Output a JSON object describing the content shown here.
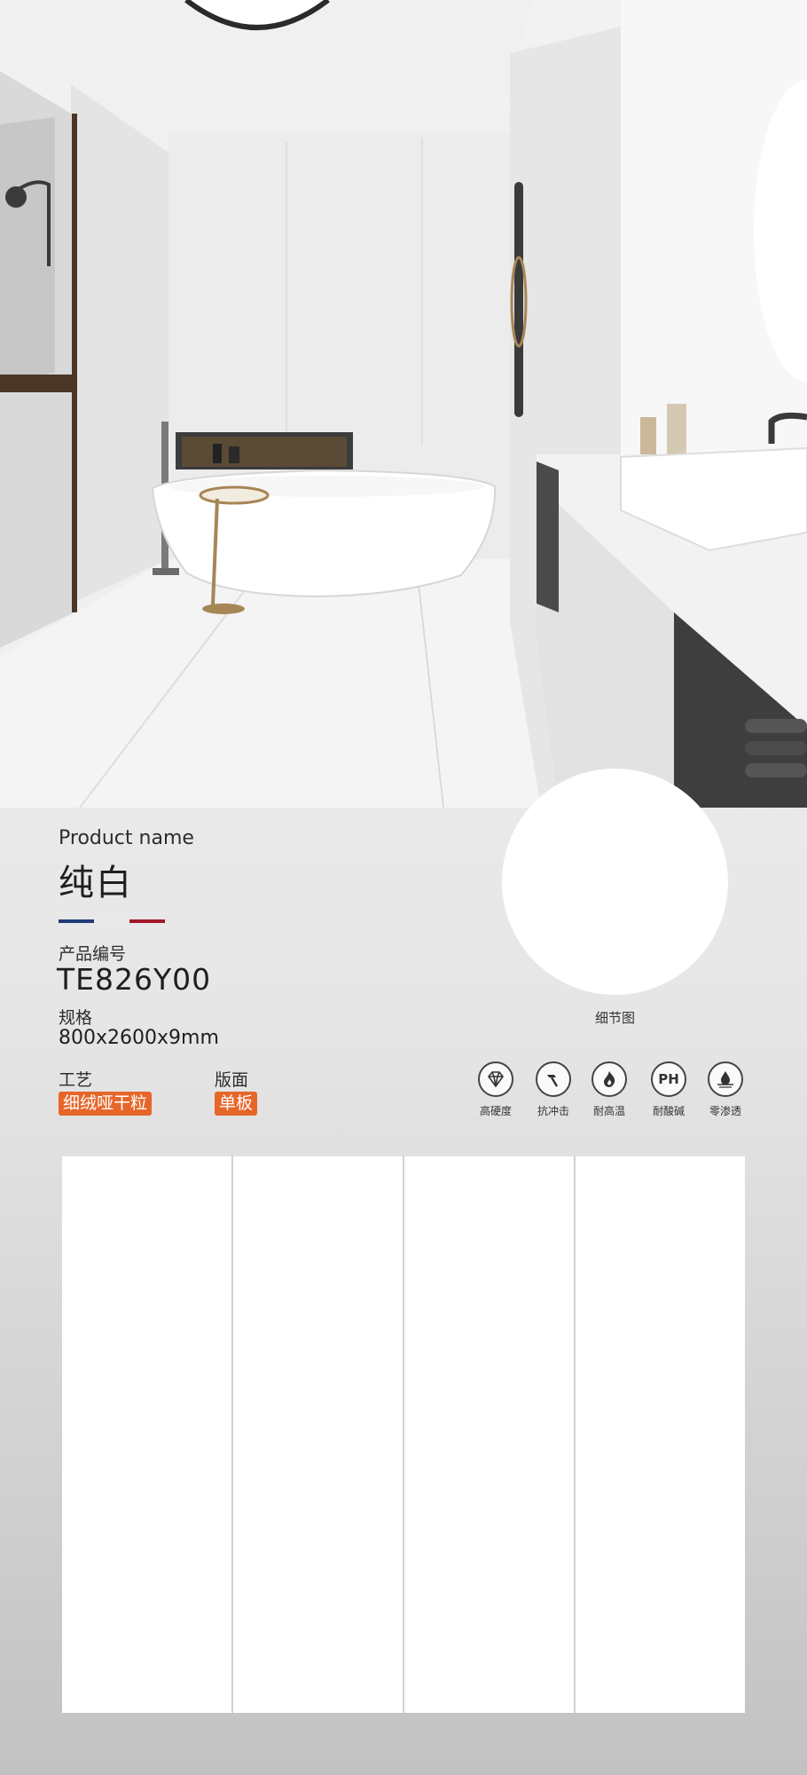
{
  "product": {
    "label_en": "Product name",
    "name_cn": "纯白",
    "code_label": "产品编号",
    "code": "TE826Y00",
    "spec_label": "规格",
    "spec": "800x2600x9mm",
    "craft_label": "工艺",
    "craft_value": "细绒哑干粒",
    "surface_label": "版面",
    "surface_value": "单板"
  },
  "detail": {
    "caption": "细节图"
  },
  "features": [
    {
      "icon": "diamond-icon",
      "label": "高硬度"
    },
    {
      "icon": "hammer-icon",
      "label": "抗冲击"
    },
    {
      "icon": "flame-icon",
      "label": "耐高温"
    },
    {
      "icon": "ph-icon",
      "label": "耐酸碱",
      "text": "PH"
    },
    {
      "icon": "water-drop-icon",
      "label": "零渗透"
    }
  ],
  "slabs": {
    "count": 4
  },
  "colors": {
    "accent_tag": "#e6662a",
    "flag_blue": "#1f3b78",
    "flag_red": "#a3182a"
  }
}
